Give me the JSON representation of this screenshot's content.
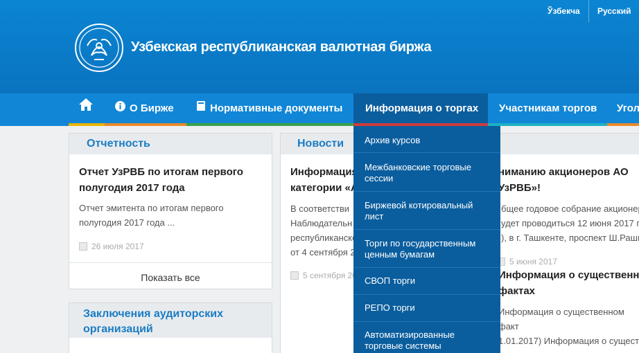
{
  "header": {
    "languages": [
      "Ўзбекча",
      "Русский"
    ],
    "site_title": "Узбекская республиканская валютная биржа"
  },
  "nav": {
    "items": [
      {
        "label": "",
        "icon": "home-icon",
        "accent": "#e8b400"
      },
      {
        "label": "О Бирже",
        "icon": "info-icon",
        "accent": "#e8892b"
      },
      {
        "label": "Нормативные документы",
        "icon": "book-icon",
        "accent": "#3aa14b"
      },
      {
        "label": "Информация о торгах",
        "icon": "",
        "accent": "#d03b3b"
      },
      {
        "label": "Участникам торгов",
        "icon": "",
        "accent": "#1cb1c4"
      },
      {
        "label": "Угол",
        "icon": "",
        "accent": "#e8892b"
      }
    ]
  },
  "dropdown": {
    "items": [
      "Архив курсов",
      "Межбанковские торговые сессии",
      "Биржевой котировальный лист",
      "Торги по государственным ценным бумагам",
      "СВОП торги",
      "РЕПО торги",
      "Автоматизированные торговые системы"
    ]
  },
  "reports": {
    "title": "Отчетность",
    "news_title": "Отчет УзРВБ по итогам первого полугодия 2017 года",
    "news_text": "Отчет эмитента по итогам первого полугодия 2017 года ...",
    "date": "26 июля 2017",
    "show_all": "Показать все"
  },
  "audit": {
    "title": "Заключения аудиторских организаций"
  },
  "news": {
    "title": "Новости",
    "item1": {
      "title_lines": [
        "Информация",
        "категории «А"
      ],
      "text_lines": [
        "В соответстви",
        "Наблюдательн",
        "республиканско",
        "от 4 сентября 2"
      ],
      "date": "5 сентября 20"
    },
    "item2": {
      "title_lines": [
        "ниманию акционеров АО",
        "УзРВБ»!"
      ],
      "text_lines": [
        "бщее годовое собрание акционер",
        "удет проводиться 12 июня 2017 го",
        "), в г. Ташкенте, проспект Ш.Раши"
      ],
      "date": "5 июня 2017"
    },
    "item3": {
      "title_lines": [
        "Информация о существенн",
        "фактах"
      ],
      "text_lines": [
        "Информация о существенном факт",
        "1.01.2017) Информация о сущест"
      ]
    }
  },
  "colors": {
    "header_blue": "#0b7fcb",
    "nav_blue": "#1186d6",
    "dropdown_blue": "#0b5e9e",
    "title_blue": "#1a7cc4"
  }
}
